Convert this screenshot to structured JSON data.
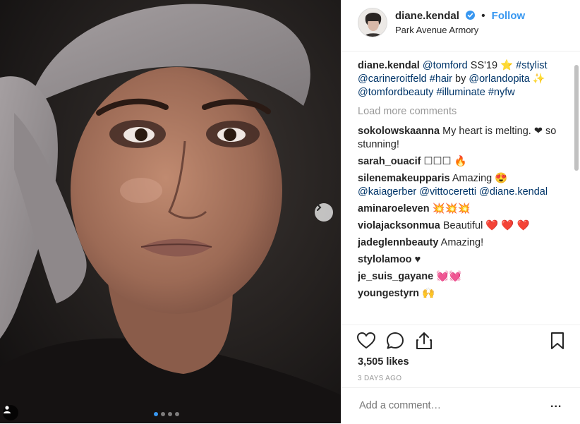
{
  "post_photo": {
    "icon": "person-icon",
    "next_icon": "chevron-right-icon",
    "carousel_dots": 4,
    "active_dot": 0
  },
  "header": {
    "username": "diane.kendal",
    "separator": "•",
    "follow_label": "Follow",
    "location": "Park Avenue Armory",
    "verified_icon": "verified-badge-icon"
  },
  "caption": {
    "username": "diane.kendal",
    "parts": [
      "@tomford",
      " SS'19 ⭐",
      "#stylist",
      "@carineroitfeld",
      "#hair",
      " by",
      "@orlandopita",
      " ✨ ",
      "@tomfordbeauty",
      "#illuminate",
      "#nyfw"
    ]
  },
  "load_more": "Load more comments",
  "comments": [
    {
      "user": "sokolowskaanna",
      "text": "My heart is melting. ❤ so stunning!"
    },
    {
      "user": "sarah_ouacif",
      "text": "☐☐☐ 🔥"
    },
    {
      "user": "silenemakeupparis",
      "text": "Amazing 😍",
      "mentions": [
        "@kaiagerber",
        "@vittoceretti",
        "@diane.kendal"
      ]
    },
    {
      "user": "aminaroeleven",
      "text": "💥💥💥"
    },
    {
      "user": "violajacksonmua",
      "text": "Beautiful ❤️ ❤️ ❤️"
    },
    {
      "user": "jadeglennbeauty",
      "text": "Amazing!"
    },
    {
      "user": "stylolamoo",
      "text": "♥"
    },
    {
      "user": "je_suis_gayane",
      "text": "💓💓"
    },
    {
      "user": "youngestyrn",
      "text": "🙌"
    }
  ],
  "actions": {
    "like_icon": "heart-icon",
    "comment_icon": "comment-icon",
    "share_icon": "share-icon",
    "save_icon": "bookmark-icon"
  },
  "likes": "3,505 likes",
  "timestamp": "3 DAYS AGO",
  "add_comment": {
    "placeholder": "Add a comment…",
    "more_label": "..."
  },
  "colors": {
    "accent": "#3897f0",
    "link": "#003569",
    "muted": "#999999"
  }
}
